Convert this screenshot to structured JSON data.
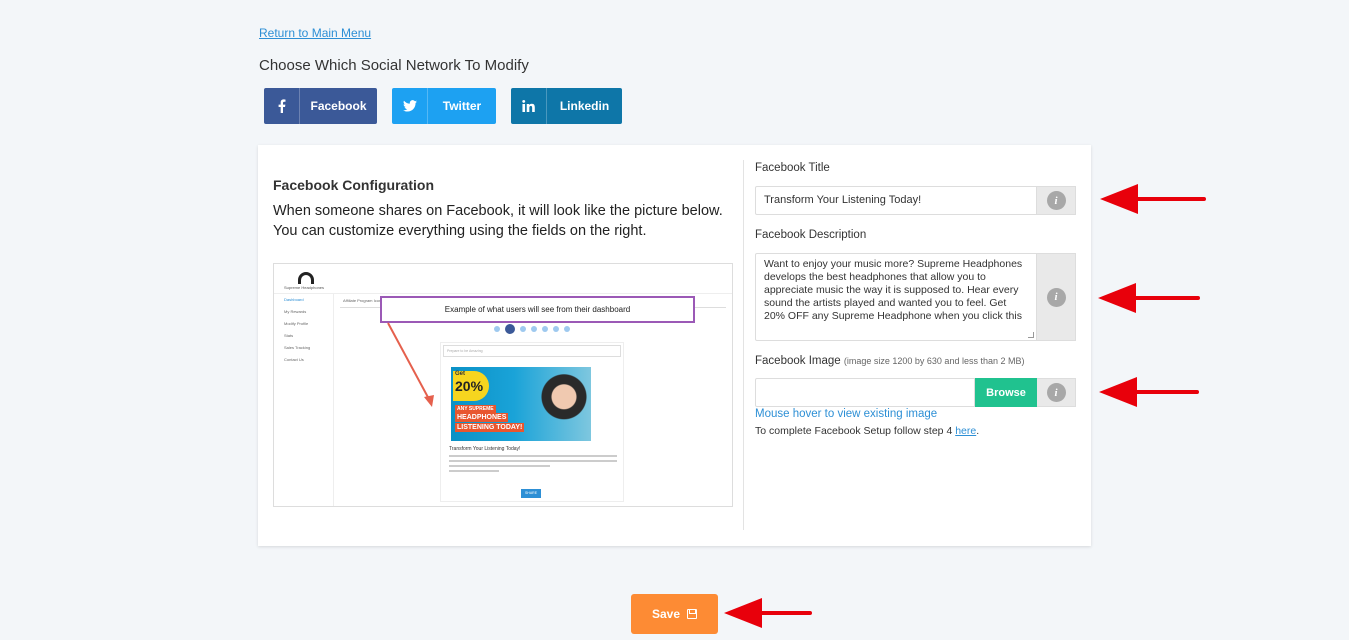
{
  "nav": {
    "back_link": "Return to Main Menu"
  },
  "networks": {
    "title": "Choose Which Social Network To Modify",
    "buttons": [
      {
        "label": "Facebook",
        "icon": "facebook-icon",
        "color": "#3b5998"
      },
      {
        "label": "Twitter",
        "icon": "twitter-icon",
        "color": "#1da1f2"
      },
      {
        "label": "Linkedin",
        "icon": "linkedin-icon",
        "color": "#0e76a8"
      }
    ]
  },
  "config": {
    "title": "Facebook Configuration",
    "description": "When someone shares on Facebook, it will look like the picture below. You can customize everything using the fields on the right."
  },
  "preview": {
    "brand": "Supreme Headphones",
    "user": "             ",
    "sidebar": [
      "Dashboard",
      "My Rewards",
      "Modify Profile",
      "Stats",
      "Sales Tracking",
      "Contact Us"
    ],
    "bar_label": "Affiliate Program Icons",
    "callout": "Example of what users will see from their dashboard",
    "input_placeholder": "Prepare to be Amazing",
    "banner": {
      "get": "Get",
      "percent": "20%",
      "line1": "ANY SUPREME",
      "line2": "HEADPHONES",
      "line3": "LISTENING TODAY!"
    },
    "card_title": "Transform Your Listening Today!",
    "share_label": "SHARE"
  },
  "form": {
    "title_label": "Facebook Title",
    "title_value": "Transform Your Listening Today!",
    "desc_label": "Facebook Description",
    "desc_value": "Want to enjoy your music more? Supreme Headphones develops the best headphones that allow you to appreciate music the way it is supposed to. Hear every sound the artists played and wanted you to feel. Get 20% OFF any Supreme Headphone when you click this",
    "image_label": "Facebook Image",
    "image_hint": "(image size 1200 by 630 and less than 2 MB)",
    "browse_label": "Browse",
    "hover_link": "Mouse hover to view existing image",
    "setup_text": "To complete Facebook Setup follow step 4 ",
    "setup_link": "here",
    "setup_end": "."
  },
  "save": {
    "label": "Save"
  },
  "colors": {
    "accent": "#2d8fd5",
    "save": "#fd8b34",
    "browse": "#20c28f",
    "arrow": "#e8000b"
  }
}
